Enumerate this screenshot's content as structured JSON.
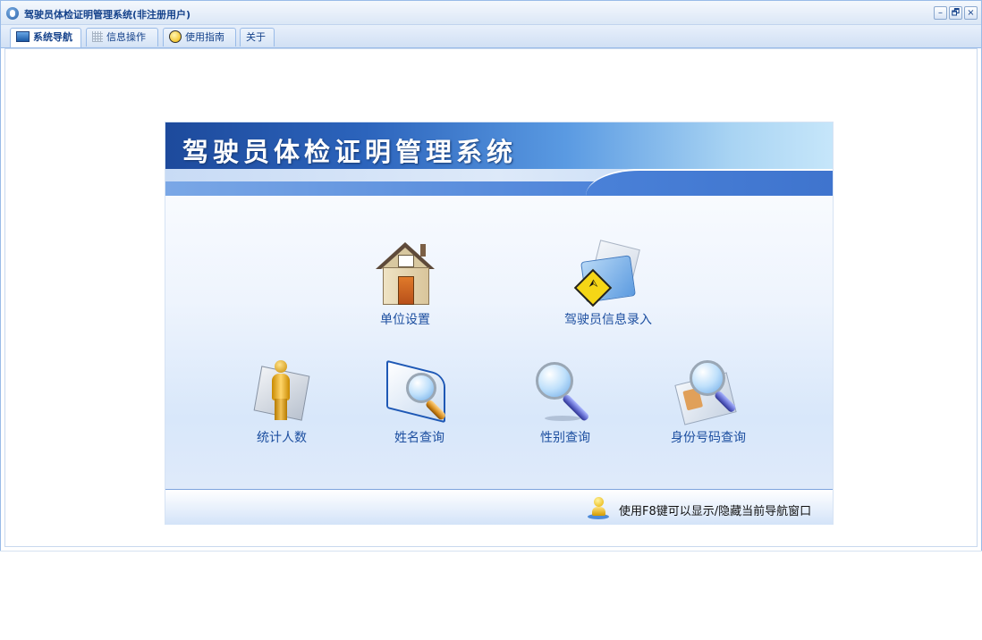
{
  "window": {
    "title": "驾驶员体检证明管理系统(非注册用户)",
    "controls": {
      "minimize": "–",
      "restore": "🗗",
      "close": "×"
    }
  },
  "tabs": [
    {
      "label": "系统导航",
      "icon": "monitor-icon",
      "active": true
    },
    {
      "label": "信息操作",
      "icon": "grid-icon",
      "active": false
    },
    {
      "label": "使用指南",
      "icon": "bulb-icon",
      "active": false
    },
    {
      "label": "关于",
      "icon": "",
      "active": false
    }
  ],
  "nav_panel": {
    "banner_title": "驾驶员体检证明管理系统",
    "items": [
      {
        "label": "单位设置",
        "icon": "house-icon"
      },
      {
        "label": "驾驶员信息录入",
        "icon": "folder-sign-icon"
      },
      {
        "label": "统计人数",
        "icon": "person-icon"
      },
      {
        "label": "姓名查询",
        "icon": "book-magnifier-icon"
      },
      {
        "label": "性别查询",
        "icon": "magnifier-icon"
      },
      {
        "label": "身份号码查询",
        "icon": "id-card-magnifier-icon"
      }
    ],
    "footer_tip": "使用F8键可以显示/隐藏当前导航窗口"
  },
  "colors": {
    "accent": "#15428b",
    "banner": "#2c64bc",
    "label": "#1d4fa0"
  }
}
